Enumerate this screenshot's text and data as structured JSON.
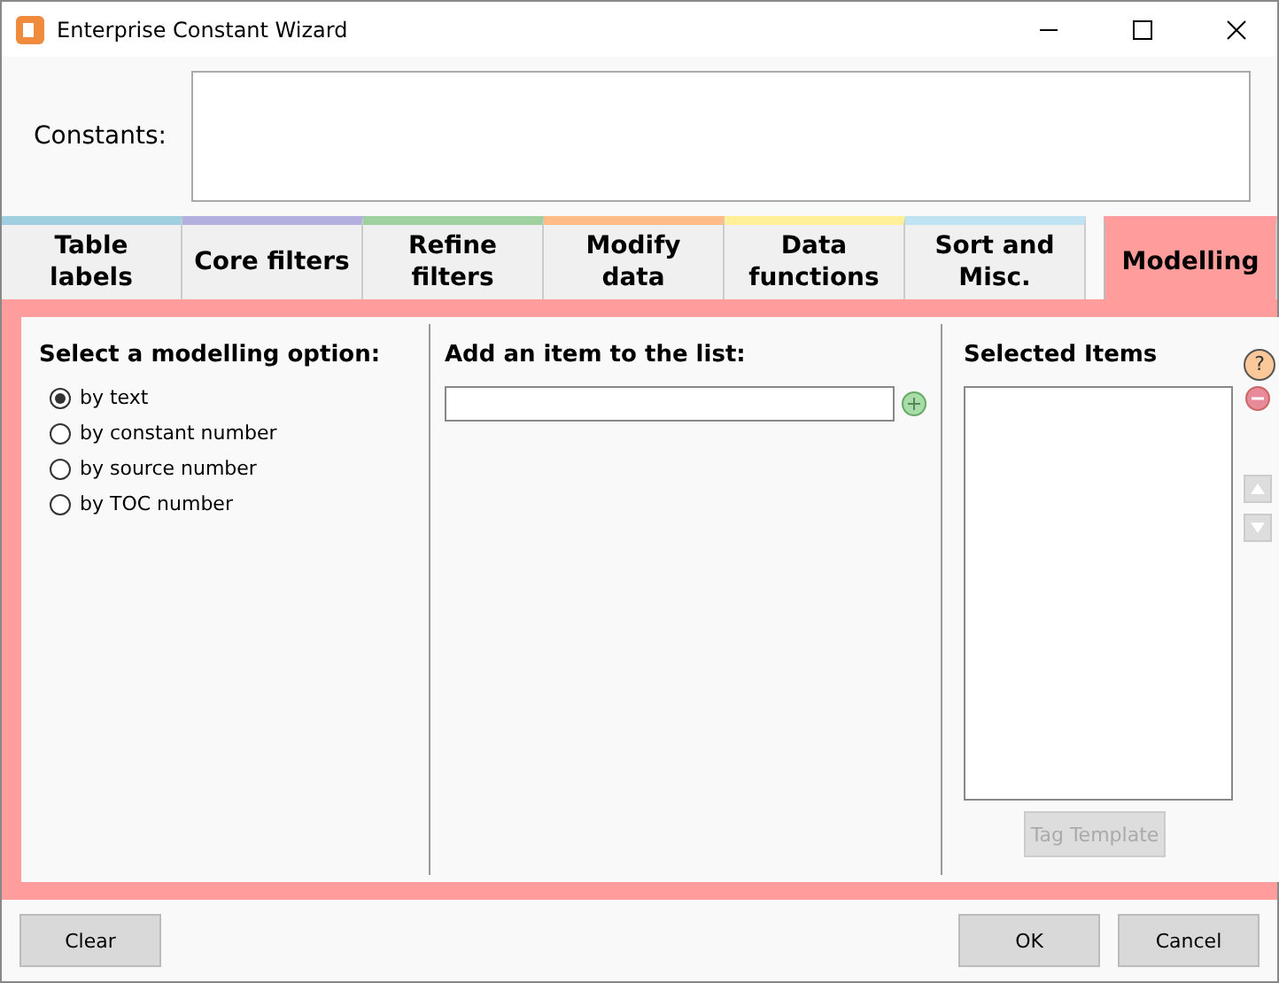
{
  "window": {
    "title": "Enterprise Constant Wizard"
  },
  "constants": {
    "label": "Constants:"
  },
  "tabs": [
    {
      "label": "Table labels",
      "color": "#9fcfe0",
      "selected": false
    },
    {
      "label": "Core filters",
      "color": "#b3b0e0",
      "selected": false
    },
    {
      "label": "Refine filters",
      "color": "#9fd09f",
      "selected": false
    },
    {
      "label": "Modify data",
      "color": "#ffbb88",
      "selected": false
    },
    {
      "label": "Data functions",
      "color": "#fff099",
      "selected": false
    },
    {
      "label": "Sort and Misc.",
      "color": "#bfe3f3",
      "selected": false
    },
    {
      "label": "Modelling",
      "color": "#ff9c9c",
      "selected": true
    }
  ],
  "options": {
    "heading": "Select a modelling option:",
    "items": [
      {
        "label": "by text",
        "selected": true
      },
      {
        "label": "by constant number",
        "selected": false
      },
      {
        "label": "by source number",
        "selected": false
      },
      {
        "label": "by TOC number",
        "selected": false
      }
    ]
  },
  "add_item": {
    "heading": "Add an item to the list:"
  },
  "selected_items": {
    "heading": "Selected Items",
    "help": "?",
    "tag_button": {
      "label": "Tag Template",
      "disabled": true
    }
  },
  "buttons": {
    "clear": "Clear",
    "ok": "OK",
    "cancel": "Cancel"
  }
}
